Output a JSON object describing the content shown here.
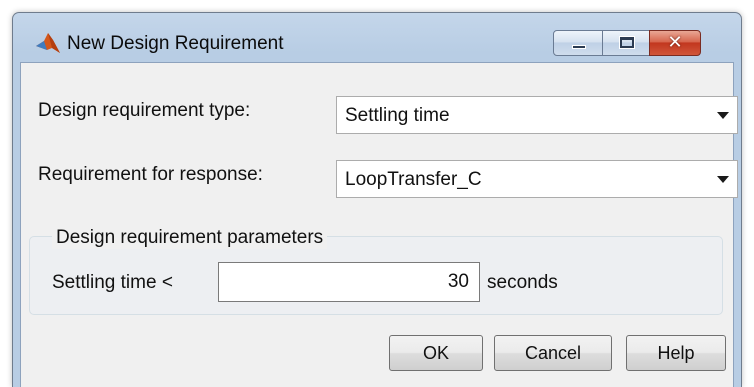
{
  "window": {
    "title": "New Design Requirement"
  },
  "form": {
    "type_label": "Design requirement type:",
    "type_value": "Settling time",
    "response_label": "Requirement for response:",
    "response_value": "LoopTransfer_C"
  },
  "params": {
    "group_title": "Design requirement parameters",
    "settling_label": "Settling time <",
    "settling_value": "30",
    "units": "seconds"
  },
  "buttons": {
    "ok": "OK",
    "cancel": "Cancel",
    "help": "Help"
  },
  "icons": {
    "app": "matlab-logo-icon",
    "minimize": "minimize-icon",
    "maximize": "maximize-icon",
    "close": "close-icon",
    "dropdown": "chevron-down-icon"
  },
  "colors": {
    "titlebar": "#b8cde4",
    "close_button": "#c2371f",
    "client_bg": "#f0f0f0"
  }
}
